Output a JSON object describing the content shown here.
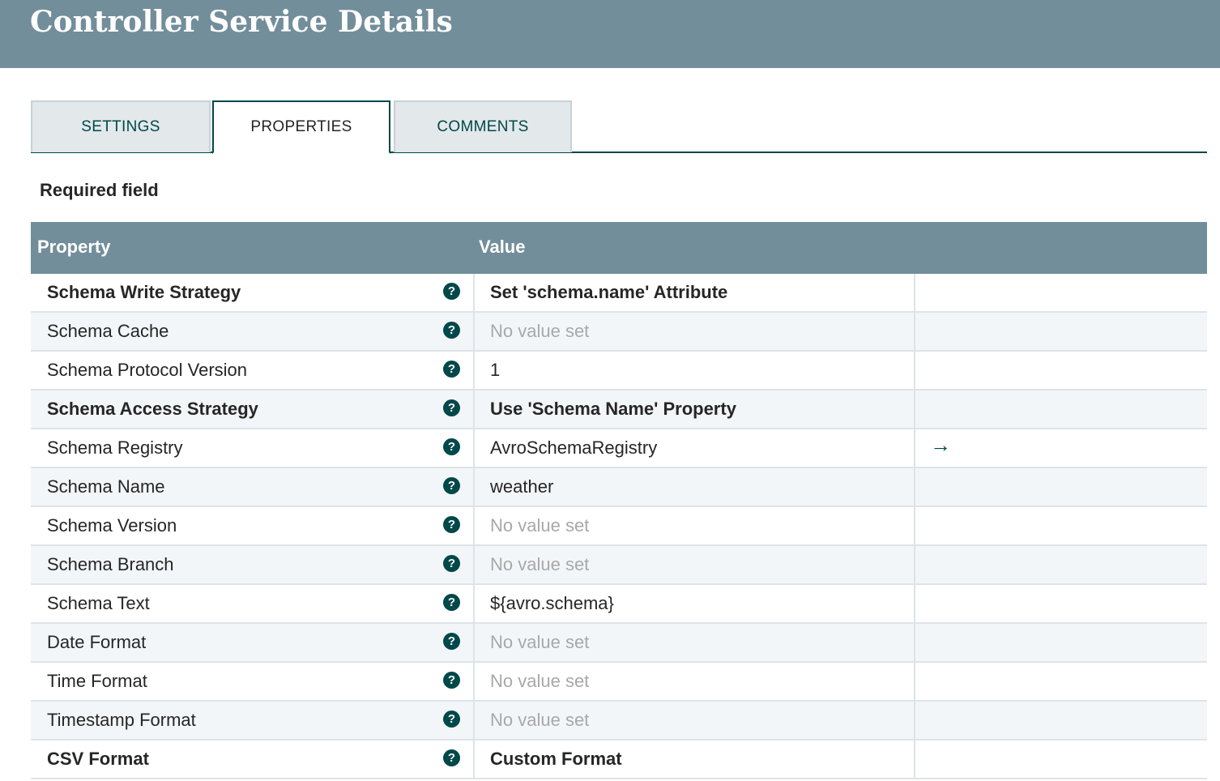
{
  "header": {
    "title": "Controller Service Details"
  },
  "tabs": [
    {
      "label": "SETTINGS"
    },
    {
      "label": "PROPERTIES"
    },
    {
      "label": "COMMENTS"
    }
  ],
  "required_label": "Required field",
  "grid": {
    "columns": [
      "Property",
      "Value"
    ],
    "rows": [
      {
        "name": "Schema Write Strategy",
        "value": "Set 'schema.name' Attribute",
        "required": true,
        "unset": false
      },
      {
        "name": "Schema Cache",
        "value": "No value set",
        "required": false,
        "unset": true
      },
      {
        "name": "Schema Protocol Version",
        "value": "1",
        "required": false,
        "unset": false
      },
      {
        "name": "Schema Access Strategy",
        "value": "Use 'Schema Name' Property",
        "required": true,
        "unset": false
      },
      {
        "name": "Schema Registry",
        "value": "AvroSchemaRegistry",
        "required": false,
        "unset": false,
        "goto": true
      },
      {
        "name": "Schema Name",
        "value": "weather",
        "required": false,
        "unset": false
      },
      {
        "name": "Schema Version",
        "value": "No value set",
        "required": false,
        "unset": true
      },
      {
        "name": "Schema Branch",
        "value": "No value set",
        "required": false,
        "unset": true
      },
      {
        "name": "Schema Text",
        "value": "${avro.schema}",
        "required": false,
        "unset": false
      },
      {
        "name": "Date Format",
        "value": "No value set",
        "required": false,
        "unset": true
      },
      {
        "name": "Time Format",
        "value": "No value set",
        "required": false,
        "unset": true
      },
      {
        "name": "Timestamp Format",
        "value": "No value set",
        "required": false,
        "unset": true
      },
      {
        "name": "CSV Format",
        "value": "Custom Format",
        "required": true,
        "unset": false
      }
    ]
  },
  "icons": {
    "help": "question-circle-icon",
    "goto": "arrow-right-icon"
  },
  "colors": {
    "header": "#728e9b",
    "accent": "#004849"
  }
}
